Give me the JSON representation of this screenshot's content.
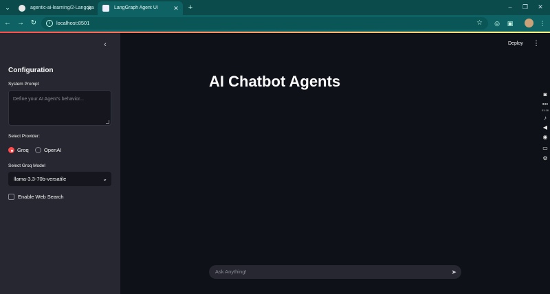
{
  "browser": {
    "tabs": [
      {
        "title": "agentic-ai-learning/2-Langcha",
        "active": false
      },
      {
        "title": "LangGraph Agent UI",
        "active": true
      }
    ],
    "url": "localhost:8501"
  },
  "header": {
    "deploy_label": "Deploy"
  },
  "sidebar": {
    "heading": "Configuration",
    "system_prompt": {
      "label": "System Prompt",
      "placeholder": "Define your AI Agent's behavior...",
      "value": ""
    },
    "provider": {
      "label": "Select Provider:",
      "options": [
        {
          "label": "Groq",
          "selected": true
        },
        {
          "label": "OpenAI",
          "selected": false
        }
      ]
    },
    "model": {
      "label": "Select Groq Model",
      "value": "llama-3.3-70b-versatile"
    },
    "web_search": {
      "label": "Enable Web Search",
      "checked": false
    }
  },
  "main": {
    "title": "AI Chatbot Agents",
    "chat_input": {
      "placeholder": "Ask Anything!"
    }
  },
  "recorder_rail": {
    "timer": "01:16"
  },
  "colors": {
    "accent": "#ff4b4b",
    "sidebar_bg": "#262730",
    "main_bg": "#0e1117",
    "browser_chrome": "#0f6263"
  }
}
